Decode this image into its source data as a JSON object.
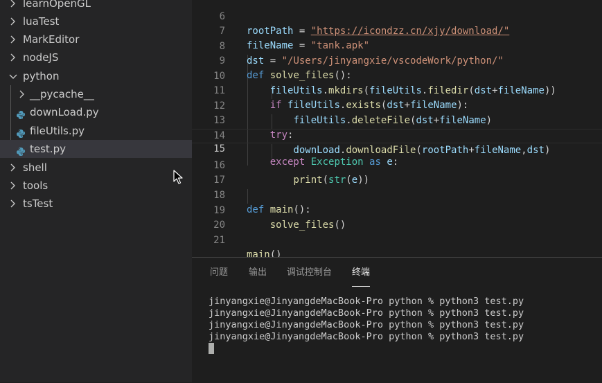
{
  "sidebar": {
    "items": [
      {
        "label": "learnOpenGL"
      },
      {
        "label": "luaTest"
      },
      {
        "label": "MarkEditor"
      },
      {
        "label": "nodeJS"
      },
      {
        "label": "python"
      },
      {
        "label": "__pycache__"
      },
      {
        "label": "downLoad.py"
      },
      {
        "label": "fileUtils.py"
      },
      {
        "label": "test.py"
      },
      {
        "label": "shell"
      },
      {
        "label": "tools"
      },
      {
        "label": "tsTest"
      }
    ]
  },
  "editor": {
    "current_line": 15,
    "line_numbers": [
      "6",
      "7",
      "8",
      "9",
      "10",
      "11",
      "12",
      "13",
      "14",
      "15",
      "16",
      "17",
      "18",
      "19",
      "20",
      "21"
    ],
    "lines": {
      "l6": {
        "var": "rootPath",
        "eq": " = ",
        "str": "\"https://icondzz.cn/xjy/download/\""
      },
      "l7": {
        "var": "fileName",
        "eq": " = ",
        "str": "\"tank.apk\""
      },
      "l8": {
        "var": "dst",
        "eq": " = ",
        "str": "\"/Users/jinyangxie/vscodeWork/python/\""
      },
      "l9": {
        "kw": "def",
        "fn": "solve_files",
        "rest": "():"
      },
      "l10": {
        "a": "fileUtils",
        "b": ".",
        "c": "mkdirs",
        "d": "(",
        "e": "fileUtils",
        "f": ".",
        "g": "filedir",
        "h": "(",
        "i": "dst",
        "j": "+",
        "k": "fileName",
        "l": "))"
      },
      "l11": {
        "kw": "if",
        "a": "fileUtils",
        "b": ".",
        "c": "exists",
        "d": "(",
        "e": "dst",
        "f": "+",
        "g": "fileName",
        "h": "):"
      },
      "l12": {
        "a": "fileUtils",
        "b": ".",
        "c": "deleteFile",
        "d": "(",
        "e": "dst",
        "f": "+",
        "g": "fileName",
        "h": ")"
      },
      "l13": {
        "kw": "try",
        "rest": ":"
      },
      "l14": {
        "a": "downLoad",
        "b": ".",
        "c": "downloadFile",
        "d": "(",
        "e": "rootPath",
        "f": "+",
        "g": "fileName",
        "h": ",",
        "i": "dst",
        "j": ")"
      },
      "l15": {
        "kw": "except",
        "cls": "Exception",
        "as": "as",
        "var": "e",
        "rest": ":"
      },
      "l16": {
        "fn": "print",
        "a": "(",
        "b": "str",
        "c": "(",
        "d": "e",
        "e": "))"
      },
      "l18": {
        "kw": "def",
        "fn": "main",
        "rest": "():"
      },
      "l19": {
        "fn": "solve_files",
        "rest": "()"
      },
      "l21": {
        "fn": "main",
        "rest": "()"
      }
    }
  },
  "panel": {
    "tabs": [
      "问题",
      "输出",
      "调试控制台",
      "终端"
    ],
    "active_tab": "终端",
    "terminal_lines": [
      "jinyangxie@JinyangdeMacBook-Pro python % python3 test.py",
      "jinyangxie@JinyangdeMacBook-Pro python % python3 test.py",
      "jinyangxie@JinyangdeMacBook-Pro python % python3 test.py",
      "jinyangxie@JinyangdeMacBook-Pro python % python3 test.py"
    ]
  },
  "colors": {
    "sidebar_bg": "#252526",
    "editor_bg": "#1e1e1e",
    "python_icon": "#519aba",
    "selected_row": "#37373d"
  },
  "icons": [
    "chevron-right-icon",
    "chevron-down-icon",
    "python-file-icon",
    "mouse-pointer-icon"
  ]
}
